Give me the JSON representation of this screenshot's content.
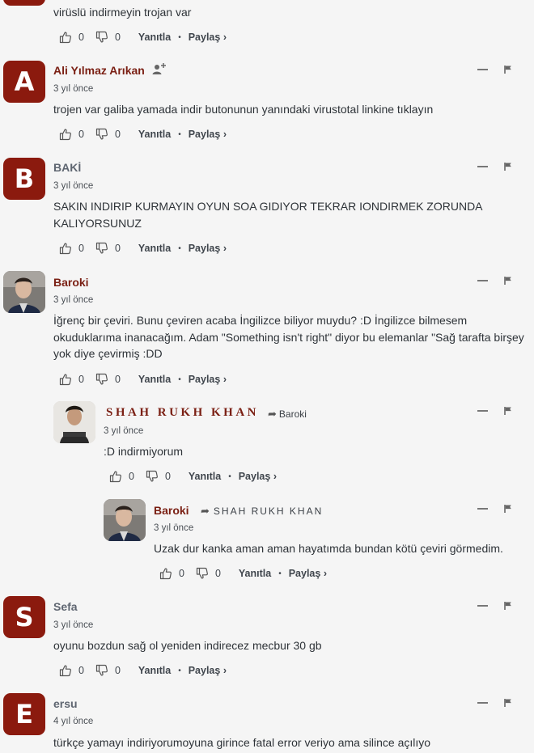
{
  "common": {
    "share_label": "Paylaş",
    "share_chevron": "›",
    "reply_label": "Yanıtla",
    "dot": "•"
  },
  "comments": [
    {
      "body": "virüslü indirmeyin trojan var",
      "likes": "0",
      "dislikes": "0"
    },
    {
      "author": "Ali Yılmaz Arıkan",
      "avatar_letter": "A",
      "time": "3 yıl önce",
      "body": "trojen var galiba yamada indir butonunun yanındaki virustotal linkine tıklayın",
      "likes": "0",
      "dislikes": "0"
    },
    {
      "author": "BAKİ",
      "avatar_letter": "B",
      "time": "3 yıl önce",
      "body": "SAKIN INDIRIP KURMAYIN OYUN SOA GIDIYOR TEKRAR IONDIRMEK ZORUNDA KALIYORSUNUZ",
      "likes": "0",
      "dislikes": "0"
    },
    {
      "author": "Baroki",
      "time": "3 yıl önce",
      "body": "İğrenç bir çeviri. Bunu çeviren acaba İngilizce biliyor muydu? :D İngilizce bilmesem okuduklarıma inanacağım. Adam \"Something isn't right\" diyor bu elemanlar \"Sağ tarafta birşey yok diye çevirmiş :DD",
      "likes": "0",
      "dislikes": "0"
    },
    {
      "author": "SHAH RUKH KHAN",
      "reply_to": "Baroki",
      "time": "3 yıl önce",
      "body": ":D indirmiyorum",
      "likes": "0",
      "dislikes": "0"
    },
    {
      "author": "Baroki",
      "reply_to": "SHAH RUKH KHAN",
      "time": "3 yıl önce",
      "body": "Uzak dur kanka aman aman hayatımda bundan kötü çeviri görmedim.",
      "likes": "0",
      "dislikes": "0"
    },
    {
      "author": "Sefa",
      "avatar_letter": "S",
      "time": "3 yıl önce",
      "body": "oyunu bozdun sağ ol yeniden indirecez mecbur 30 gb",
      "likes": "0",
      "dislikes": "0"
    },
    {
      "author": "ersu",
      "avatar_letter": "E",
      "time": "4 yıl önce",
      "body": "türkçe yamayı indiriyorumoyuna girince fatal error veriyo ama silince açılıyo"
    }
  ],
  "colors": {
    "accent": "#8b1a0e",
    "author": "#7a1f13",
    "background": "#f5f5f5"
  }
}
